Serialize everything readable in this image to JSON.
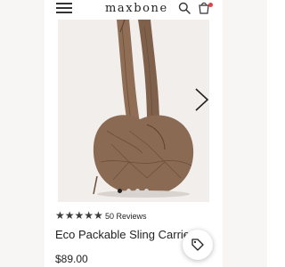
{
  "header": {
    "logo": "maxbone",
    "menu_icon": "hamburger-menu-icon",
    "search_icon": "search-icon",
    "cart_icon": "shopping-bag-icon"
  },
  "carousel": {
    "image": "quilted brown sling bag",
    "next_icon": "chevron-right-icon",
    "dot_count": 4,
    "active_dot": 1
  },
  "product": {
    "stars": "★★★★★",
    "rating": 5,
    "reviews_label": "50 Reviews",
    "title": "Eco Packable Sling Carrier",
    "price": "$89.00"
  },
  "colors": {
    "bag": "#8a6a52",
    "image_bg": "#f1eeec",
    "badge": "#e0424a"
  },
  "fab": {
    "icon": "tag-icon"
  }
}
